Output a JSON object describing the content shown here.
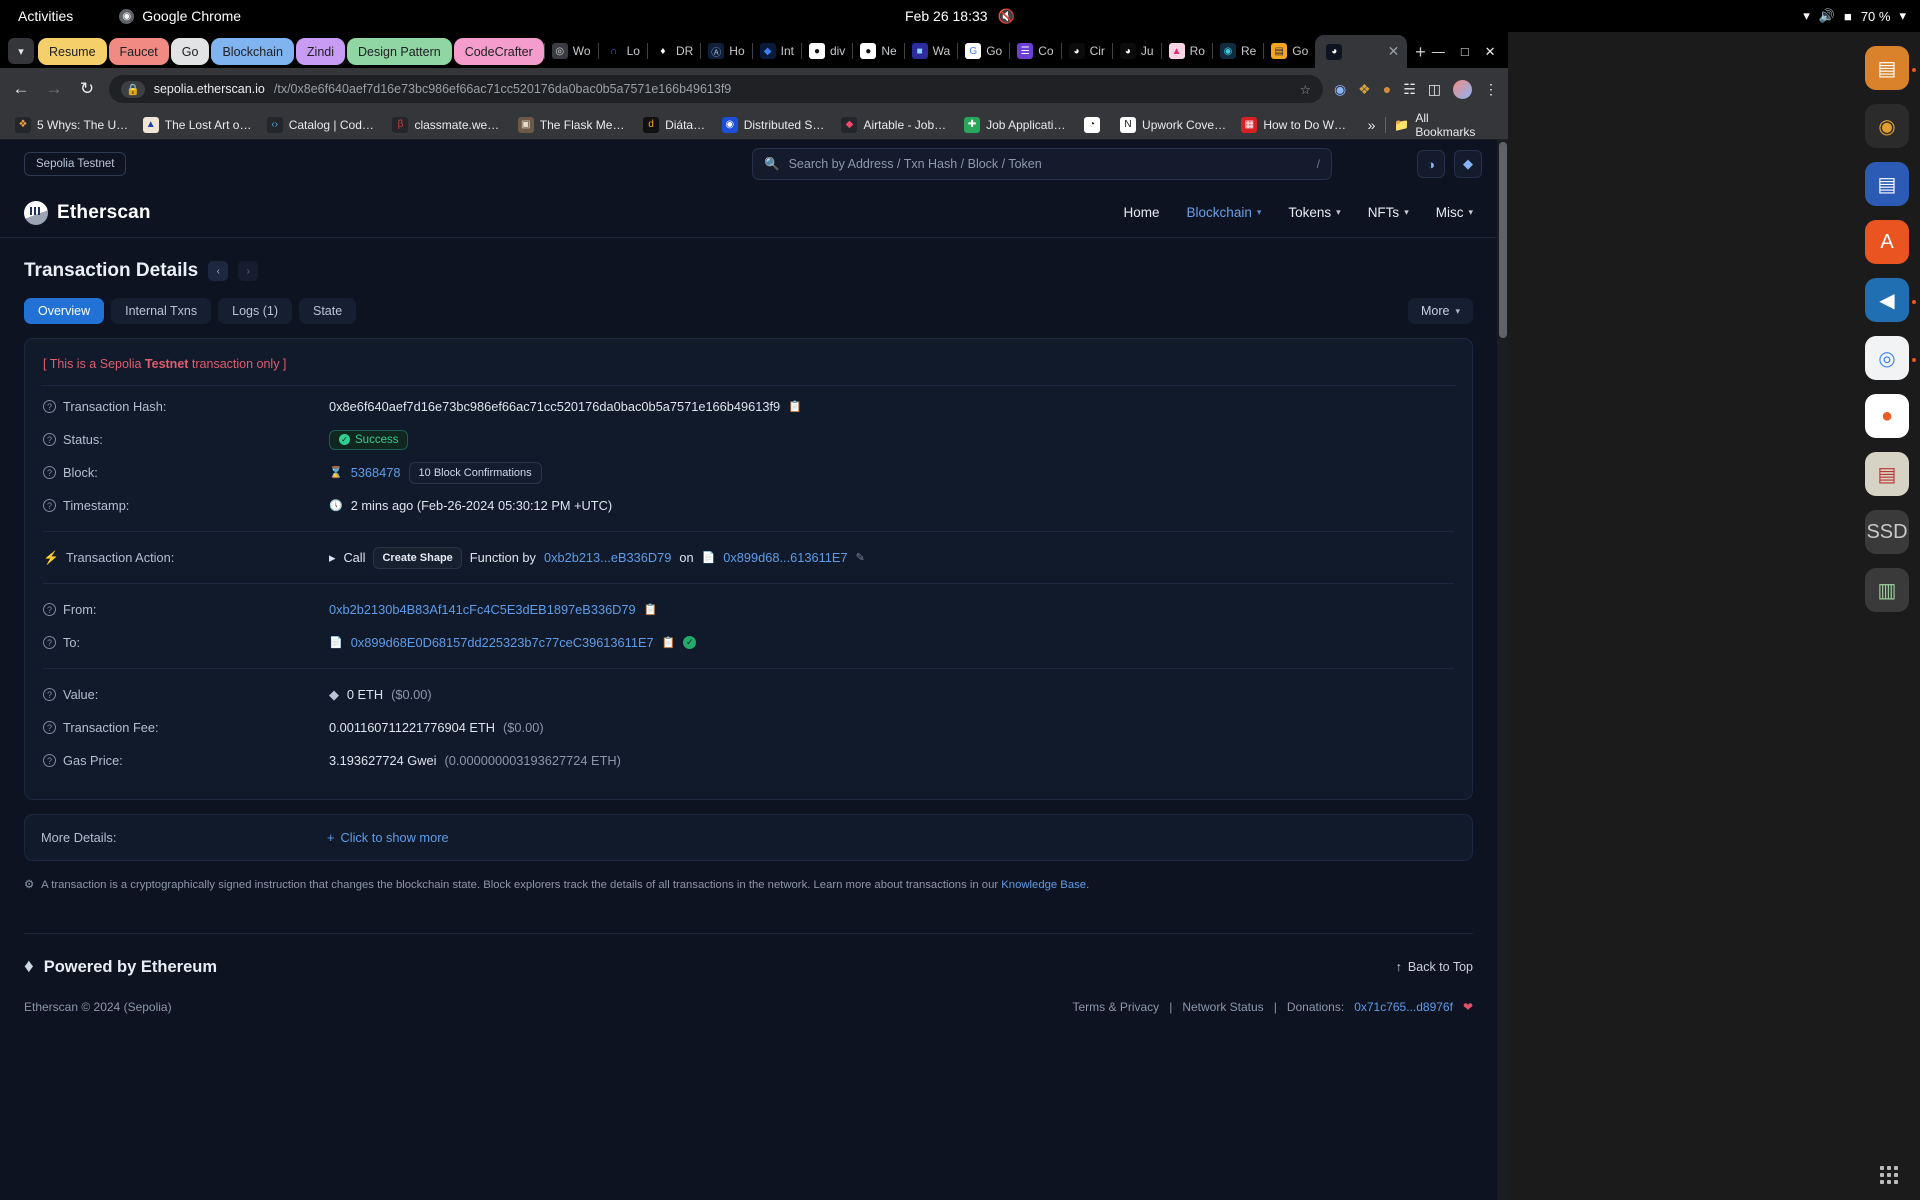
{
  "os_bar": {
    "activities": "Activities",
    "app_name": "Google Chrome",
    "clock": "Feb 26  18:33",
    "battery": "70 %"
  },
  "chrome": {
    "pinned_tabs": [
      {
        "label": "Resume",
        "color": "#f5d06a"
      },
      {
        "label": "Faucet",
        "color": "#f18a83"
      },
      {
        "label": "Go",
        "color": "#e2e3e5"
      },
      {
        "label": "Blockchain",
        "color": "#7fb4f0"
      },
      {
        "label": "Zindi",
        "color": "#c89bf5"
      },
      {
        "label": "Design Pattern",
        "color": "#8fd6a2"
      },
      {
        "label": "CodeCrafter",
        "color": "#f49ccb"
      }
    ],
    "icon_tabs": [
      {
        "label": "Wo",
        "glyph": "◎",
        "bg": "#3a3b40",
        "fg": "#d0d3d8"
      },
      {
        "label": "Lo",
        "glyph": "∩",
        "bg": "#000000",
        "fg": "#2f6df6"
      },
      {
        "label": "DR",
        "glyph": "♦",
        "bg": "#000000",
        "fg": "#ffffff"
      },
      {
        "label": "Ho",
        "glyph": "Ⓐ",
        "bg": "#10203a",
        "fg": "#9fb6d8"
      },
      {
        "label": "Int",
        "glyph": "◆",
        "bg": "#0a1a3a",
        "fg": "#3c7ef0"
      },
      {
        "label": "div",
        "glyph": "●",
        "bg": "#ffffff",
        "fg": "#111111"
      },
      {
        "label": "Ne",
        "glyph": "●",
        "bg": "#ffffff",
        "fg": "#111111"
      },
      {
        "label": "Wa",
        "glyph": "■",
        "bg": "#2b2d9e",
        "fg": "#8fd1ff"
      },
      {
        "label": "Go",
        "glyph": "G",
        "bg": "#ffffff",
        "fg": "#4285f4"
      },
      {
        "label": "Co",
        "glyph": "☰",
        "bg": "#6b3fd4",
        "fg": "#ffffff"
      },
      {
        "label": "Cir",
        "glyph": "◕",
        "bg": "#0b0b0b",
        "fg": "#ffffff"
      },
      {
        "label": "Ju",
        "glyph": "◕",
        "bg": "#0b0b0b",
        "fg": "#ffffff"
      },
      {
        "label": "Ro",
        "glyph": "▲",
        "bg": "#fbd5e5",
        "fg": "#e0306e"
      },
      {
        "label": "Re",
        "glyph": "◉",
        "bg": "#0f2b3d",
        "fg": "#3ec8e0"
      },
      {
        "label": "Go",
        "glyph": "▤",
        "bg": "#f5a524",
        "fg": "#2b2b2b"
      }
    ],
    "active_tab": {
      "label": "",
      "favicon": "etherscan-icon"
    },
    "new_tab_label": "+",
    "window_controls": {
      "minimize": "—",
      "maximize": "□",
      "close": "✕"
    },
    "omnibox": {
      "domain": "sepolia.etherscan.io",
      "path": "/tx/0x8e6f640aef7d16e73bc986ef66ac71cc520176da0bac0b5a7571e166b49613f9",
      "lock": "lock-icon"
    },
    "bookmarks": [
      {
        "label": "5 Whys: The Ul...",
        "glyph": "❖",
        "bg": "#23262b",
        "fg": "#f3a33c"
      },
      {
        "label": "The Lost Art of...",
        "glyph": "▲",
        "bg": "#efe6d5",
        "fg": "#1d3fb8"
      },
      {
        "label": "Catalog | Code...",
        "glyph": "‹›",
        "bg": "#23262b",
        "fg": "#4fb3d9"
      },
      {
        "label": "classmate.web...",
        "glyph": "β",
        "bg": "#23262b",
        "fg": "#d63a3a"
      },
      {
        "label": "The Flask Meg...",
        "glyph": "▣",
        "bg": "#6b5a48",
        "fg": "#e8dcc8"
      },
      {
        "label": "Diátaxis",
        "glyph": "d",
        "bg": "#111111",
        "fg": "#f5a524"
      },
      {
        "label": "Distributed Sy...",
        "glyph": "◉",
        "bg": "#1b4fd8",
        "fg": "#ffffff"
      },
      {
        "label": "Airtable - Jobs...",
        "glyph": "◆",
        "bg": "#23262b",
        "fg": "#f04a6e"
      },
      {
        "label": "Job Applicatio...",
        "glyph": "✚",
        "bg": "#2aa65c",
        "fg": "#ffffff"
      },
      {
        "label": "",
        "glyph": "◔",
        "bg": "#ffffff",
        "fg": "#111111"
      },
      {
        "label": "Upwork Cover...",
        "glyph": "N",
        "bg": "#ffffff",
        "fg": "#111111"
      },
      {
        "label": "How to Do Wh...",
        "glyph": "▦",
        "bg": "#d81f26",
        "fg": "#ffffff"
      }
    ],
    "bookmarks_overflow": "»",
    "all_bookmarks": "All Bookmarks"
  },
  "etherscan": {
    "testnet_pill": "Sepolia Testnet",
    "search_placeholder": "Search by Address / Txn Hash / Block / Token",
    "search_shortcut": "/",
    "brand": "Etherscan",
    "nav": [
      {
        "label": "Home",
        "has_caret": false,
        "active": false
      },
      {
        "label": "Blockchain",
        "has_caret": true,
        "active": true
      },
      {
        "label": "Tokens",
        "has_caret": true,
        "active": false
      },
      {
        "label": "NFTs",
        "has_caret": true,
        "active": false
      },
      {
        "label": "Misc",
        "has_caret": true,
        "active": false
      }
    ],
    "page_title": "Transaction Details",
    "tabs": [
      {
        "label": "Overview",
        "selected": true
      },
      {
        "label": "Internal Txns",
        "selected": false
      },
      {
        "label": "Logs (1)",
        "selected": false
      },
      {
        "label": "State",
        "selected": false
      }
    ],
    "more_button": "More",
    "testnet_notice_prefix": "[ This is a Sepolia ",
    "testnet_notice_bold": "Testnet",
    "testnet_notice_suffix": " transaction only ]",
    "rows": {
      "txhash_label": "Transaction Hash:",
      "txhash_value": "0x8e6f640aef7d16e73bc986ef66ac71cc520176da0bac0b5a7571e166b49613f9",
      "status_label": "Status:",
      "status_value": "Success",
      "block_label": "Block:",
      "block_value": "5368478",
      "block_confirmations": "10 Block Confirmations",
      "timestamp_label": "Timestamp:",
      "timestamp_value": "2 mins ago (Feb-26-2024 05:30:12 PM +UTC)",
      "action_label": "Transaction Action:",
      "action_call": "Call",
      "action_function": "Create Shape",
      "action_mid": "Function by",
      "action_from": "0xb2b213...eB336D79",
      "action_on": "on",
      "action_to": "0x899d68...613611E7",
      "from_label": "From:",
      "from_value": "0xb2b2130b4B83Af141cFc4C5E3dEB1897eB336D79",
      "to_label": "To:",
      "to_value": "0x899d68E0D68157dd225323b7c77ceC39613611E7",
      "value_label": "Value:",
      "value_eth": "0 ETH",
      "value_usd": "($0.00)",
      "fee_label": "Transaction Fee:",
      "fee_eth": "0.001160711221776904 ETH",
      "fee_usd": "($0.00)",
      "gas_label": "Gas Price:",
      "gas_gwei": "3.193627724 Gwei",
      "gas_eth": "(0.000000003193627724 ETH)"
    },
    "more_details_label": "More Details:",
    "more_details_link": "Click to show more",
    "footnote": "A transaction is a cryptographically signed instruction that changes the blockchain state. Block explorers track the details of all transactions in the network. Learn more about transactions in our",
    "footnote_link": "Knowledge Base",
    "footnote_period": ".",
    "powered_by": "Powered by Ethereum",
    "back_to_top": "Back to Top",
    "copyright": "Etherscan © 2024 (Sepolia)",
    "footer_links": [
      "Terms & Privacy",
      "Network Status"
    ],
    "donations_label": "Donations:",
    "donations_address": "0x71c765...d8976f"
  },
  "dock": {
    "items": [
      {
        "name": "files-icon",
        "glyph": "▤",
        "bg": "#d9822b",
        "fg": "#ffffff",
        "running": true
      },
      {
        "name": "rhythmbox-icon",
        "glyph": "◉",
        "bg": "#2b2b2b",
        "fg": "#e0a030",
        "running": false
      },
      {
        "name": "libreoffice-writer-icon",
        "glyph": "▤",
        "bg": "#2b5bb5",
        "fg": "#ffffff",
        "running": false
      },
      {
        "name": "ubuntu-software-icon",
        "glyph": "A",
        "bg": "#e95420",
        "fg": "#ffffff",
        "running": false
      },
      {
        "name": "vscode-icon",
        "glyph": "◀",
        "bg": "#1f6fb2",
        "fg": "#ffffff",
        "running": true
      },
      {
        "name": "chrome-icon",
        "glyph": "◎",
        "bg": "#f1f3f4",
        "fg": "#4285f4",
        "running": true
      },
      {
        "name": "postman-icon",
        "glyph": "●",
        "bg": "#ffffff",
        "fg": "#ef5b25",
        "running": false
      },
      {
        "name": "pdf-reader-icon",
        "glyph": "▤",
        "bg": "#d6d2c4",
        "fg": "#b33",
        "running": false
      },
      {
        "name": "ssd-drive-icon",
        "glyph": "SSD",
        "bg": "#3a3a3a",
        "fg": "#c8c8c8",
        "running": false
      },
      {
        "name": "trash-icon",
        "glyph": "▥",
        "bg": "#3a3a3a",
        "fg": "#9fd39f",
        "running": false
      }
    ],
    "show_apps": "show-applications-icon"
  }
}
